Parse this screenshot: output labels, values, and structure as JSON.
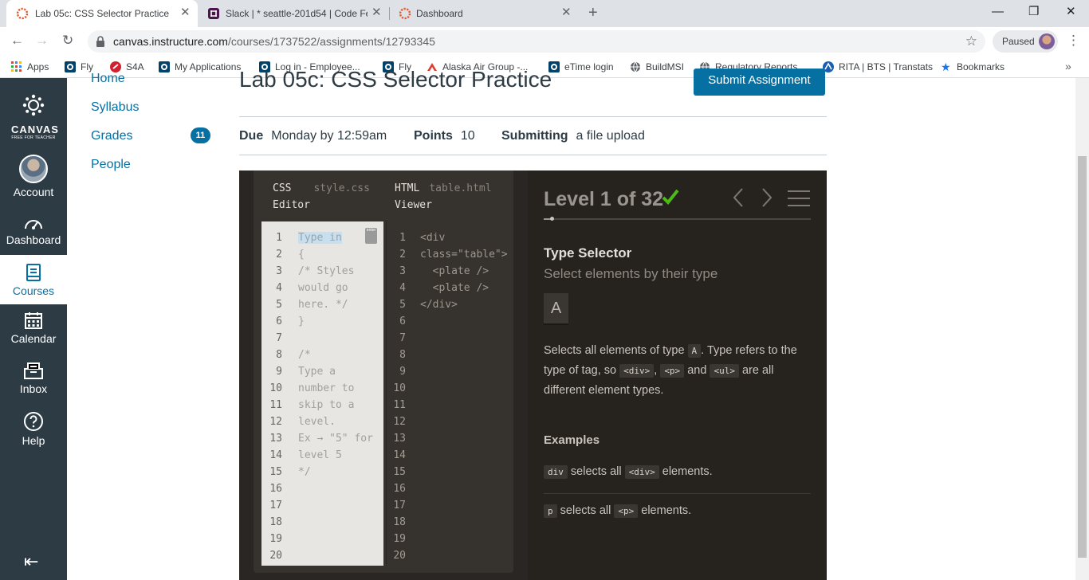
{
  "browser": {
    "tabs": [
      {
        "title": "Lab 05c: CSS Selector Practice"
      },
      {
        "title": "Slack | * seattle-201d54 | Code Fe"
      },
      {
        "title": "Dashboard"
      }
    ],
    "url_host": "canvas.instructure.com",
    "url_path": "/courses/1737522/assignments/12793345",
    "profile_label": "Paused",
    "bookmarks": [
      "Apps",
      "Fly",
      "S4A",
      "My Applications",
      "Log in - Employee...",
      "Fly",
      "Alaska Air Group -...",
      "eTime login",
      "BuildMSI",
      "Regulatory Reports...",
      "RITA | BTS | Transtats",
      "Bookmarks"
    ]
  },
  "global_nav": {
    "logo_word": "CANVAS",
    "logo_sub": "FREE FOR TEACHER",
    "items": [
      {
        "label": "Account",
        "icon": "avatar"
      },
      {
        "label": "Dashboard",
        "icon": "dashboard-icon"
      },
      {
        "label": "Courses",
        "icon": "book-icon"
      },
      {
        "label": "Calendar",
        "icon": "calendar-icon"
      },
      {
        "label": "Inbox",
        "icon": "inbox-icon"
      },
      {
        "label": "Help",
        "icon": "help-icon"
      }
    ]
  },
  "course_nav": {
    "items": [
      "Home",
      "Syllabus",
      "Grades",
      "People"
    ],
    "grades_badge": "11"
  },
  "assignment": {
    "title": "Lab 05c: CSS Selector Practice",
    "submit_label": "Submit Assignment",
    "due_label": "Due",
    "due_value": "Monday by 12:59am",
    "points_label": "Points",
    "points_value": "10",
    "submitting_label": "Submitting",
    "submitting_value": "a file upload"
  },
  "game": {
    "css_title_a": "CSS",
    "css_title_b": "Editor",
    "css_file": "style.css",
    "html_title_a": "HTML",
    "html_title_b": "Viewer",
    "html_file": "table.html",
    "enter_label": "enter",
    "line_numbers": [
      "1",
      "2",
      "3",
      "4",
      "5",
      "6",
      "7",
      "8",
      "9",
      "10",
      "11",
      "12",
      "13",
      "14",
      "15",
      "16",
      "17",
      "18",
      "19",
      "20"
    ],
    "css_input": "Type in",
    "css_lines": [
      "{",
      "/* Styles",
      "would go",
      "here. */",
      "}",
      "",
      "/*",
      "Type a",
      "number to",
      "skip to a",
      "level.",
      "Ex → \"5\" for",
      "level 5",
      "*/"
    ],
    "html_lines": [
      "<div",
      "class=\"table\">",
      "  <plate />",
      "  <plate />",
      "</div>"
    ],
    "level_text": "Level 1 of 32",
    "level_progress": 0.03,
    "selector_name": "Type Selector",
    "selector_sub": "Select elements by their type",
    "syntax": "A",
    "desc_1": "Selects all elements of type",
    "desc_code_a": "A",
    "desc_2": ". Type refers to the type of tag, so",
    "desc_code_div": "<div>",
    "desc_3": ",",
    "desc_code_p": "<p>",
    "desc_4": "and",
    "desc_code_ul": "<ul>",
    "desc_5": "are all different element types.",
    "examples_heading": "Examples",
    "ex1_code": "div",
    "ex1_text": "selects all",
    "ex1_tag": "<div>",
    "ex1_end": "elements.",
    "ex2_code": "p",
    "ex2_text": "selects all",
    "ex2_tag": "<p>",
    "ex2_end": "elements."
  }
}
